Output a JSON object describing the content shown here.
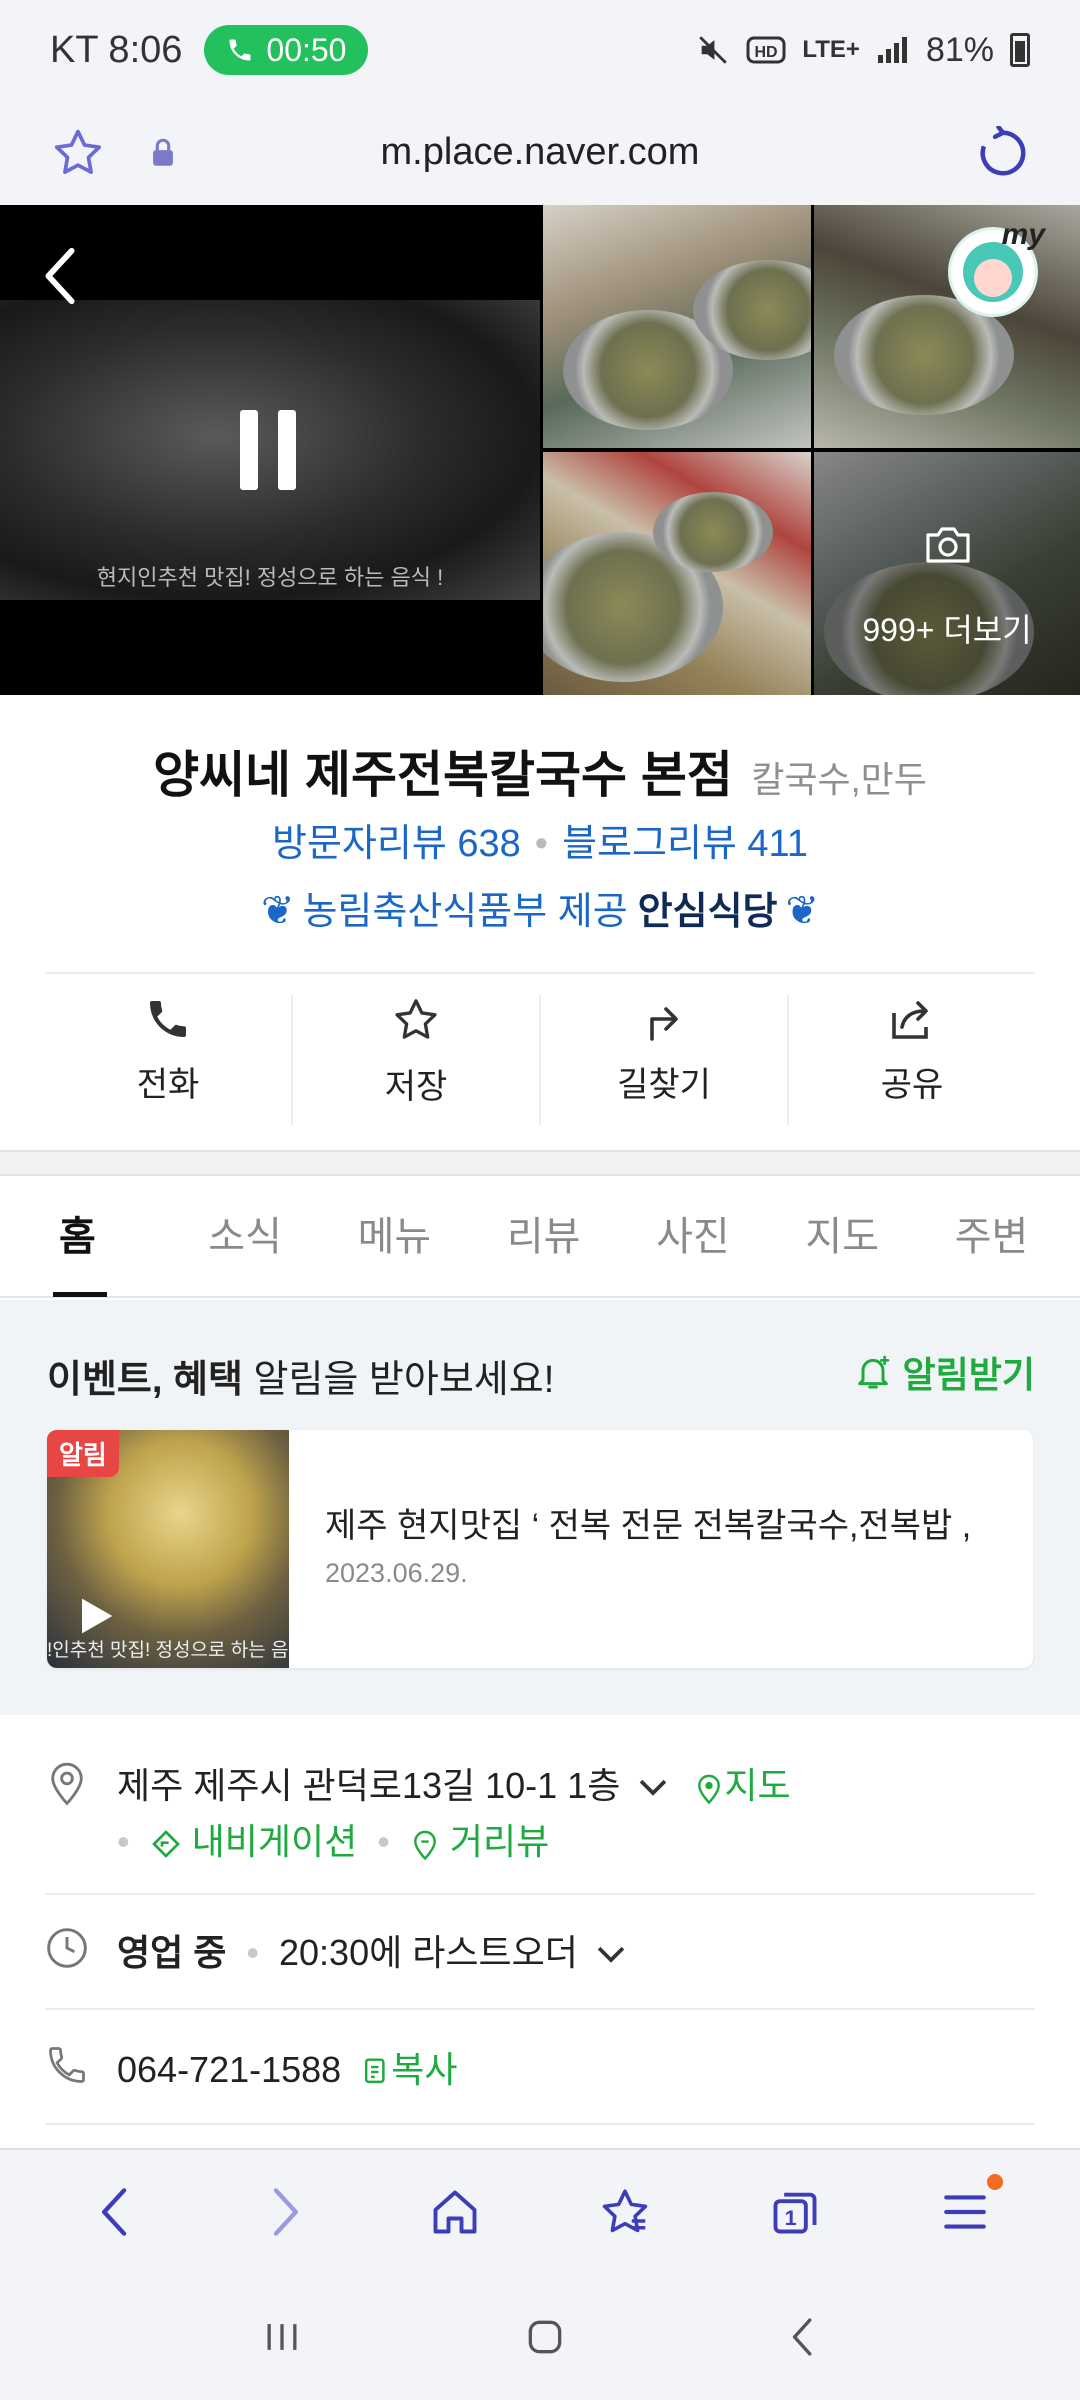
{
  "status_bar": {
    "carrier_time": "KT 8:06",
    "call_timer": "00:50",
    "network": "LTE+",
    "battery": "81%"
  },
  "browser": {
    "url": "m.place.naver.com"
  },
  "photos": {
    "video_caption": "현지인추천 맛집! 정성으로 하는 음식 !",
    "more_label": "999+ 더보기",
    "avatar_label": "my"
  },
  "place": {
    "name": "양씨네 제주전복칼국수 본점",
    "category": "칼국수,만두",
    "visitor_reviews": "방문자리뷰 638",
    "blog_reviews": "블로그리뷰 411",
    "badge_provider": "농림축산식품부 제공",
    "badge_name": "안심식당"
  },
  "actions": [
    {
      "label": "전화",
      "icon": "phone-icon"
    },
    {
      "label": "저장",
      "icon": "star-icon"
    },
    {
      "label": "길찾기",
      "icon": "directions-icon"
    },
    {
      "label": "공유",
      "icon": "share-icon"
    }
  ],
  "tabs": [
    "홈",
    "소식",
    "메뉴",
    "리뷰",
    "사진",
    "지도",
    "주변"
  ],
  "event": {
    "head_bold": "이벤트, 혜택",
    "head_rest": "알림을 받아보세요!",
    "subscribe_label": "알림받기",
    "card_tag": "알림",
    "card_title": "제주 현지맛집 ‘ 전복 전문 전복칼국수,전복밥 ,",
    "card_date": "2023.06.29.",
    "thumb_caption": "!인추천 맛집! 정성으로 하는 음"
  },
  "info": {
    "address": "제주 제주시 관덕로13길 10-1 1층",
    "map_link": "지도",
    "navigation_link": "내비게이션",
    "street_view_link": "거리뷰",
    "status": "영업 중",
    "last_order": "20:30에 라스트오더",
    "phone": "064-721-1588",
    "copy_label": "복사"
  },
  "colors": {
    "link_blue": "#1a67c7",
    "green": "#1faa3f",
    "browser_icon": "#3d3db8"
  }
}
